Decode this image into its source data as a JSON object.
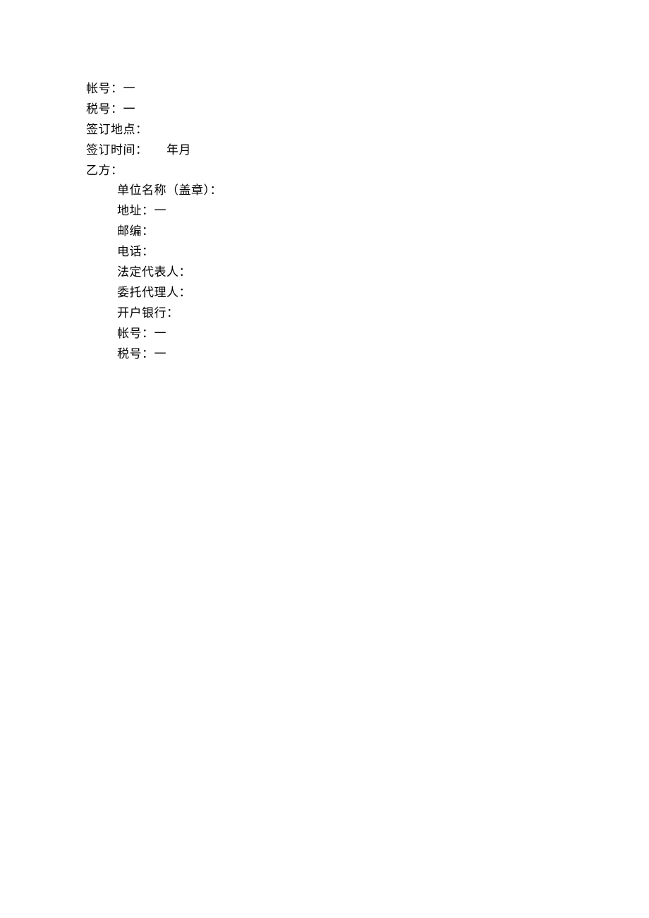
{
  "lines": [
    {
      "text": "帐号：一",
      "indent": false
    },
    {
      "text": "税号：一",
      "indent": false
    },
    {
      "text": "签订地点：",
      "indent": false
    },
    {
      "text": "签订时间：　　年月",
      "indent": false
    },
    {
      "text": "乙方：",
      "indent": false
    },
    {
      "text": "单位名称（盖章）：",
      "indent": true
    },
    {
      "text": "地址：一",
      "indent": true
    },
    {
      "text": "邮编：",
      "indent": true
    },
    {
      "text": "电话：",
      "indent": true
    },
    {
      "text": "法定代表人：",
      "indent": true
    },
    {
      "text": "委托代理人：",
      "indent": true
    },
    {
      "text": "开户银行：",
      "indent": true
    },
    {
      "text": "帐号：一",
      "indent": true
    },
    {
      "text": "税号：一",
      "indent": true
    }
  ]
}
